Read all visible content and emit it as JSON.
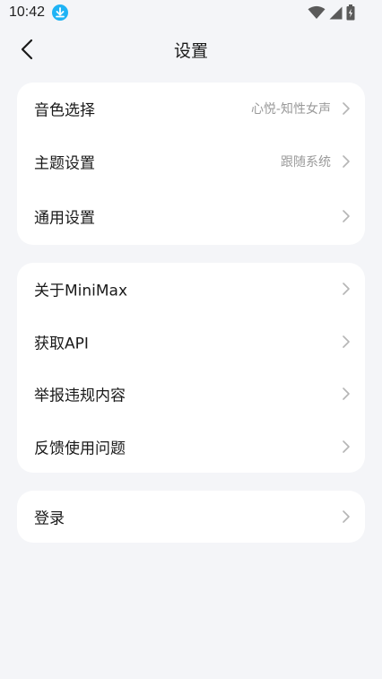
{
  "status_bar": {
    "time": "10:42"
  },
  "header": {
    "title": "设置"
  },
  "groups": [
    {
      "items": [
        {
          "label": "音色选择",
          "value": "心悦-知性女声"
        },
        {
          "label": "主题设置",
          "value": "跟随系统"
        },
        {
          "label": "通用设置",
          "value": ""
        }
      ]
    },
    {
      "items": [
        {
          "label": "关于MiniMax",
          "value": ""
        },
        {
          "label": "获取API",
          "value": ""
        },
        {
          "label": "举报违规内容",
          "value": ""
        },
        {
          "label": "反馈使用问题",
          "value": ""
        }
      ]
    },
    {
      "items": [
        {
          "label": "登录",
          "value": ""
        }
      ]
    }
  ],
  "colors": {
    "background": "#f4f5f8",
    "card": "#ffffff",
    "download_badge": "#1fb3f5",
    "secondary_text": "#9a9a9a",
    "chevron": "#b5b5b5"
  },
  "icons": [
    "download-icon",
    "wifi-icon",
    "cellular-signal-icon",
    "battery-icon",
    "back-arrow-icon",
    "chevron-right-icon"
  ]
}
